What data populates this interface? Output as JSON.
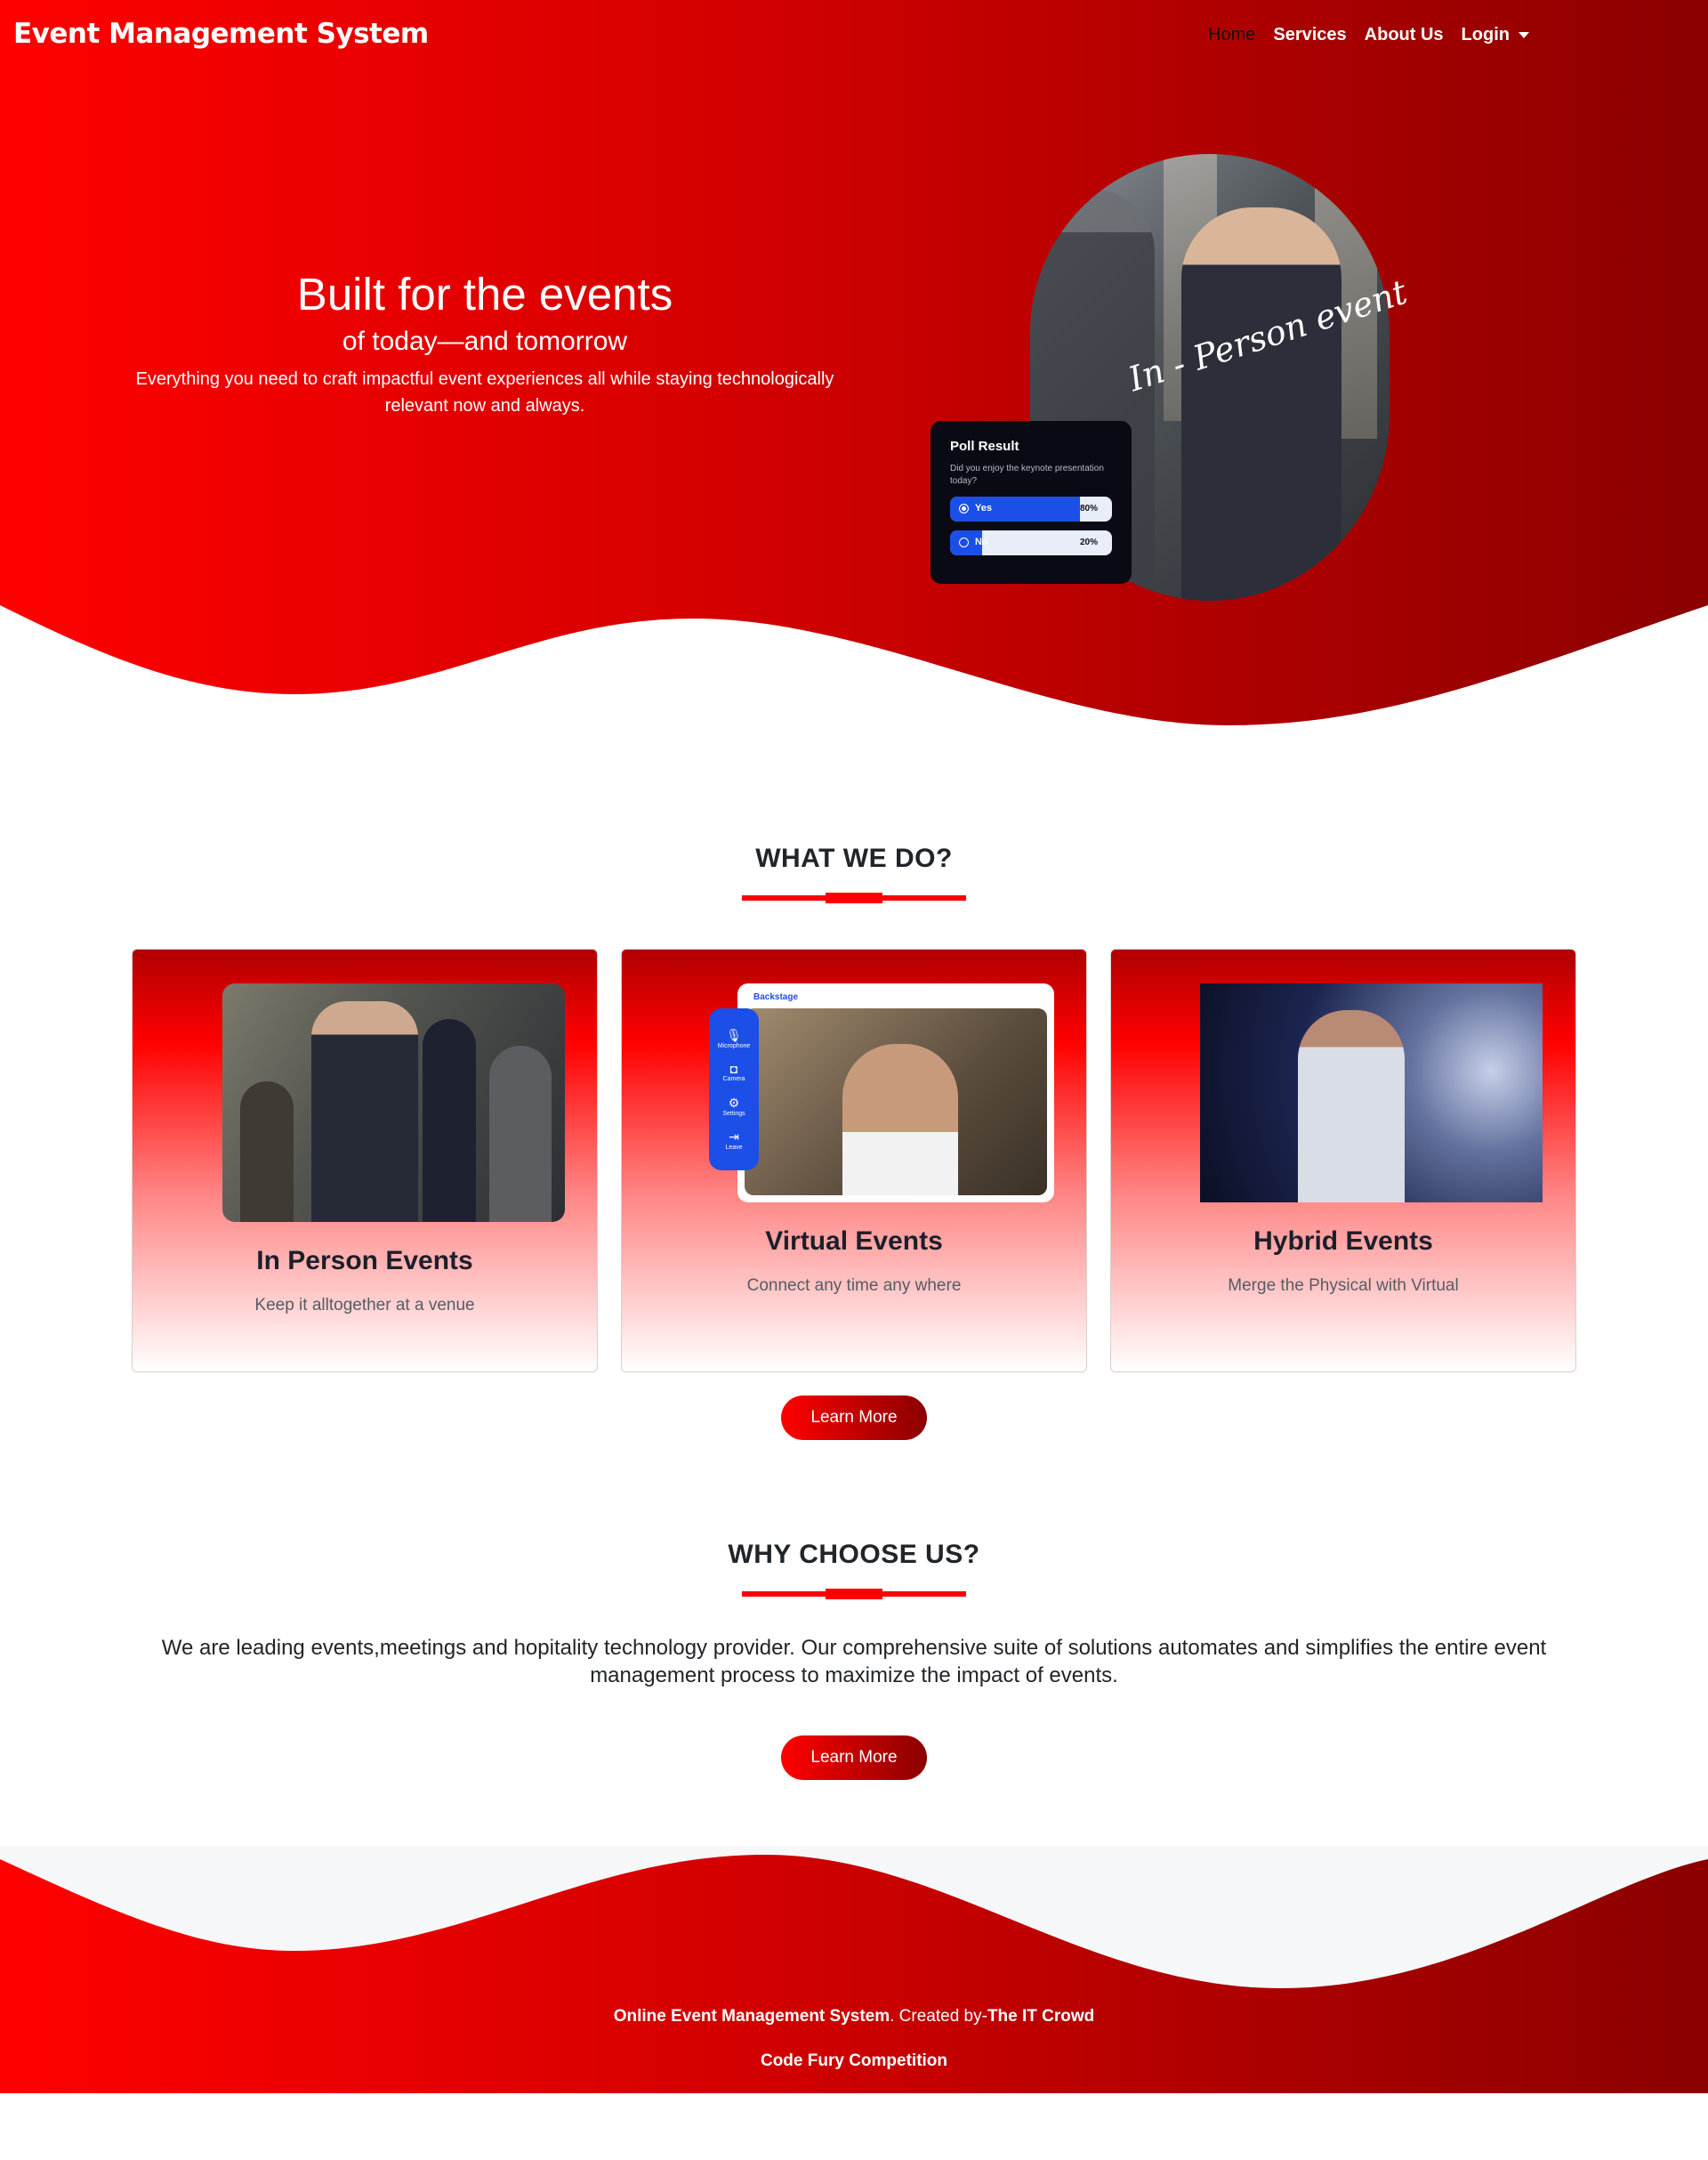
{
  "navbar": {
    "brand": "Event Management System",
    "links": [
      {
        "label": "Home",
        "active": true
      },
      {
        "label": "Services"
      },
      {
        "label": "About Us"
      },
      {
        "label": "Login",
        "dropdown": true
      }
    ]
  },
  "hero": {
    "title": "Built for the events",
    "subtitle": "of today—and tomorrow",
    "description": "Everything you need to craft impactful event experiences all while staying technologically relevant now and always.",
    "image_caption": "In - Person event",
    "poll": {
      "title": "Poll Result",
      "question": "Did you enjoy the keynote presentation today?",
      "options": [
        {
          "label": "Yes",
          "percent": "80%",
          "fraction": 0.8,
          "selected": true
        },
        {
          "label": "No",
          "percent": "20%",
          "fraction": 0.2,
          "selected": false
        }
      ]
    }
  },
  "what_we_do": {
    "heading": "WHAT WE DO?",
    "cards": [
      {
        "title": "In Person Events",
        "description": "Keep it alltogether at a venue"
      },
      {
        "title": "Virtual Events",
        "description": "Connect any time any where",
        "app_name": "Backstage",
        "controls": [
          "Microphone",
          "Camera",
          "Settings",
          "Leave"
        ]
      },
      {
        "title": "Hybrid Events",
        "description": "Merge the Physical with Virtual"
      }
    ],
    "button_label": "Learn More"
  },
  "why_choose_us": {
    "heading": "WHY CHOOSE US?",
    "text": "We are leading events,meetings and hopitality technology provider. Our comprehensive suite of solutions automates and simplifies the entire event management process to maximize the impact of events.",
    "button_label": "Learn More"
  },
  "footer": {
    "system_name": "Online Event Management System",
    "created_by_label": ". Created by-",
    "team": "The IT Crowd",
    "competition": "Code Fury Competition"
  },
  "colors": {
    "brand_red": "#ff0000",
    "dark_red": "#8b0000",
    "poll_blue": "#1b4fe8"
  }
}
